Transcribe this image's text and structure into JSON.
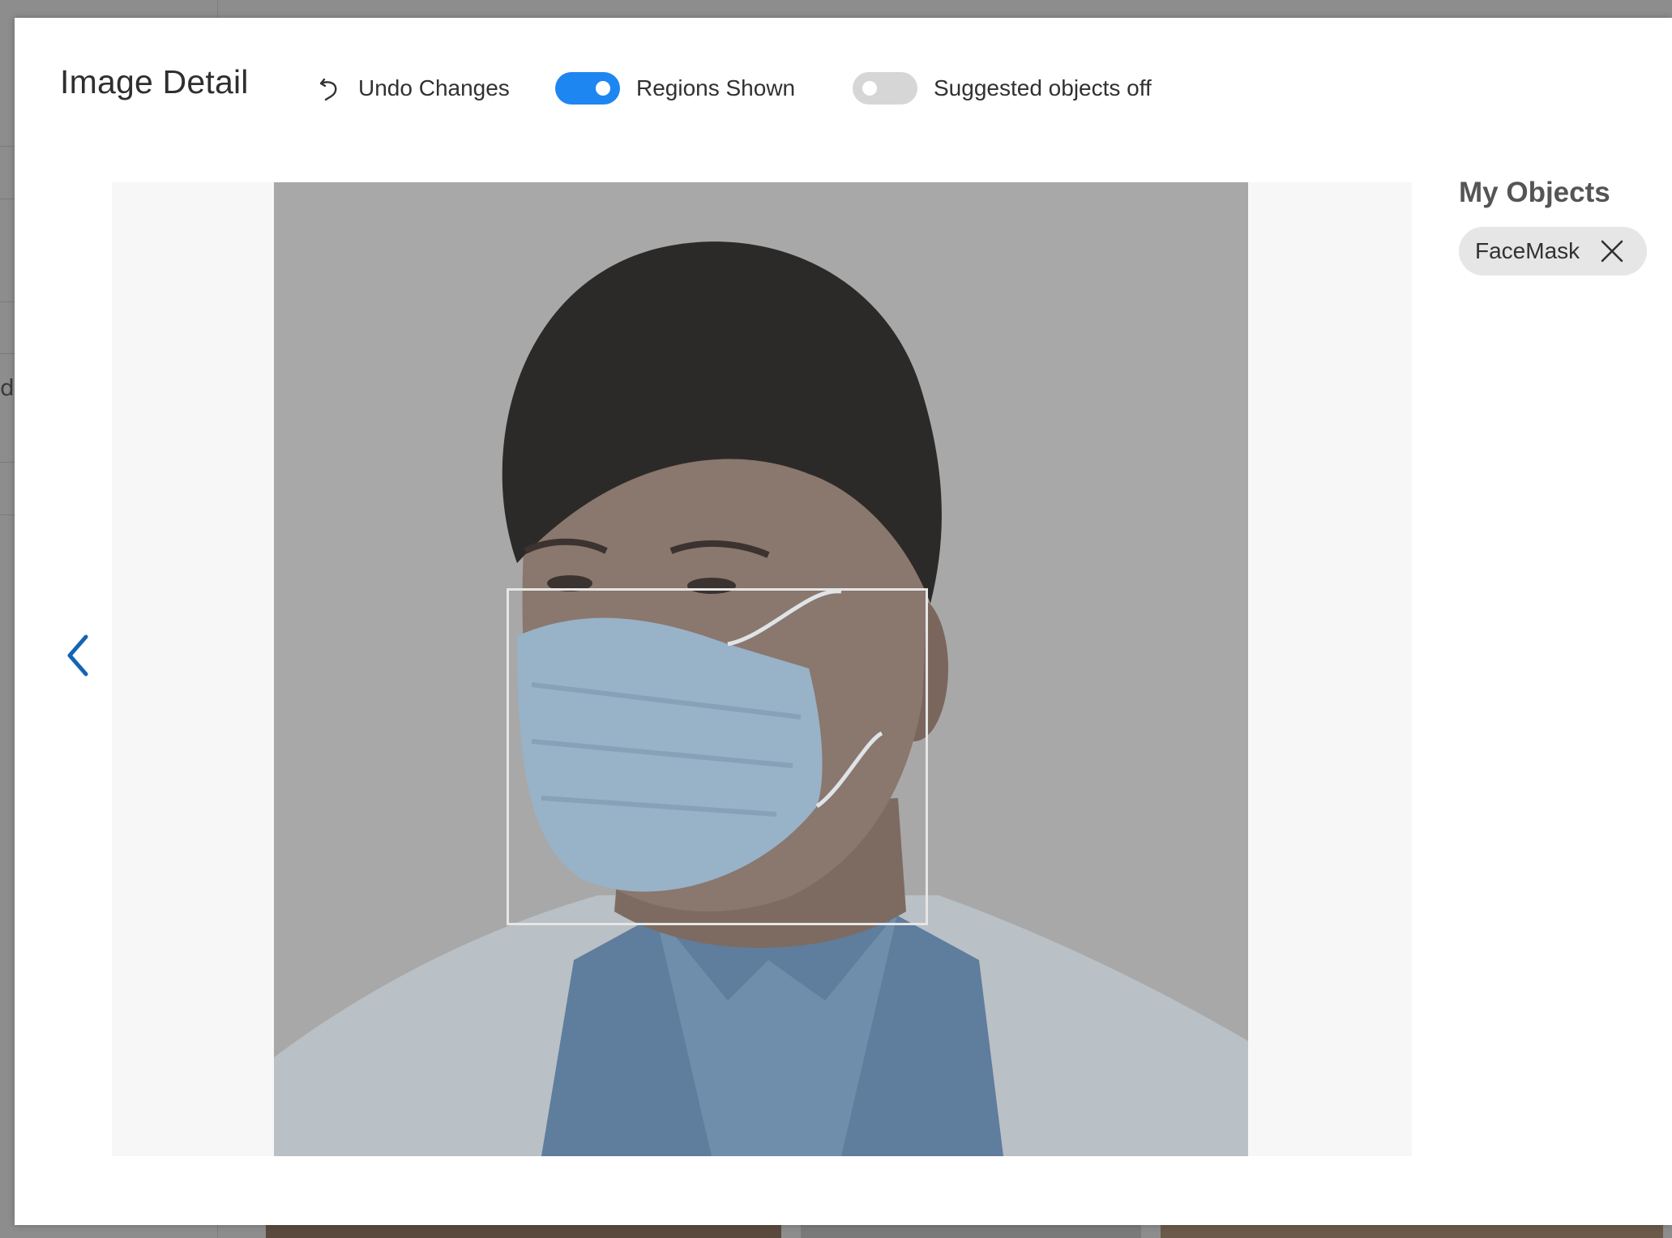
{
  "modal": {
    "title": "Image Detail"
  },
  "toolbar": {
    "undo_label": "Undo Changes",
    "regions_toggle": {
      "label": "Regions Shown",
      "state": "on"
    },
    "suggested_toggle": {
      "label": "Suggested objects off",
      "state": "off"
    }
  },
  "objects_panel": {
    "heading": "My Objects",
    "tags": [
      {
        "label": "FaceMask"
      }
    ]
  },
  "backdrop": {
    "partial_text": "d"
  },
  "colors": {
    "accent": "#1e86f0",
    "nav_arrow": "#1464b4",
    "toggle_off": "#d6d6d6",
    "chip_bg": "#e6e6e6"
  }
}
